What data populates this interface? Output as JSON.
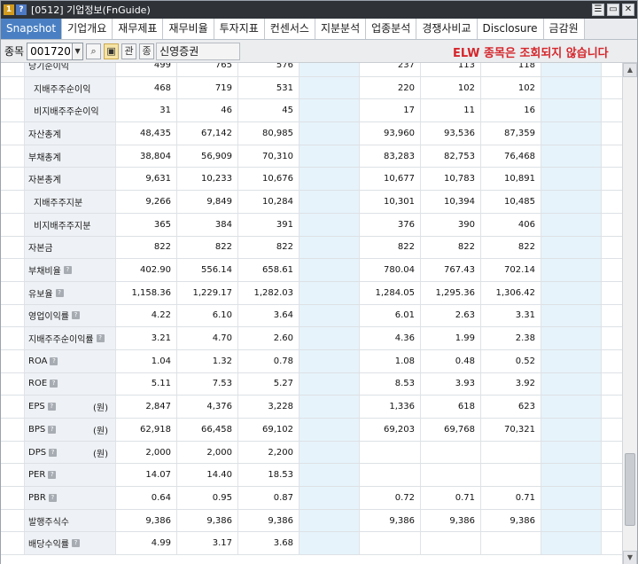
{
  "window": {
    "badge_num": "1",
    "badge_q": "?",
    "title": "[0512] 기업정보(FnGuide)",
    "controls": [
      "☰",
      "▭",
      "✕"
    ]
  },
  "tabs": [
    "Snapshot",
    "기업개요",
    "재무제표",
    "재무비율",
    "투자지표",
    "컨센서스",
    "지분분석",
    "업종분석",
    "경쟁사비교",
    "Disclosure",
    "금감원"
  ],
  "search": {
    "label": "종목",
    "code": "001720",
    "dropdown_icon": "▼",
    "search_icon": "⌕",
    "folder_icon": "▣",
    "btn_gwan": "관",
    "btn_sang": "종",
    "company": "신영증권",
    "notice": "ELW 종목은 조회되지 않습니다"
  },
  "columns_blue": [
    3,
    7
  ],
  "rows": [
    {
      "label": "당기순이익",
      "level": "top",
      "q": false,
      "unit": "",
      "values": [
        "499",
        "765",
        "576",
        "",
        "237",
        "113",
        "118",
        ""
      ]
    },
    {
      "label": "지배주주순이익",
      "level": "ind",
      "q": false,
      "unit": "",
      "values": [
        "468",
        "719",
        "531",
        "",
        "220",
        "102",
        "102",
        ""
      ]
    },
    {
      "label": "비지배주주순이익",
      "level": "ind",
      "q": false,
      "unit": "",
      "values": [
        "31",
        "46",
        "45",
        "",
        "17",
        "11",
        "16",
        ""
      ]
    },
    {
      "label": "자산총계",
      "level": "top",
      "q": false,
      "unit": "",
      "values": [
        "48,435",
        "67,142",
        "80,985",
        "",
        "93,960",
        "93,536",
        "87,359",
        ""
      ]
    },
    {
      "label": "부채총계",
      "level": "top",
      "q": false,
      "unit": "",
      "values": [
        "38,804",
        "56,909",
        "70,310",
        "",
        "83,283",
        "82,753",
        "76,468",
        ""
      ]
    },
    {
      "label": "자본총계",
      "level": "top",
      "q": false,
      "unit": "",
      "values": [
        "9,631",
        "10,233",
        "10,676",
        "",
        "10,677",
        "10,783",
        "10,891",
        ""
      ]
    },
    {
      "label": "지배주주지분",
      "level": "ind",
      "q": false,
      "unit": "",
      "values": [
        "9,266",
        "9,849",
        "10,284",
        "",
        "10,301",
        "10,394",
        "10,485",
        ""
      ]
    },
    {
      "label": "비지배주주지분",
      "level": "ind",
      "q": false,
      "unit": "",
      "values": [
        "365",
        "384",
        "391",
        "",
        "376",
        "390",
        "406",
        ""
      ]
    },
    {
      "label": "자본금",
      "level": "top",
      "q": false,
      "unit": "",
      "values": [
        "822",
        "822",
        "822",
        "",
        "822",
        "822",
        "822",
        ""
      ]
    },
    {
      "label": "부채비율",
      "level": "top",
      "q": true,
      "unit": "",
      "values": [
        "402.90",
        "556.14",
        "658.61",
        "",
        "780.04",
        "767.43",
        "702.14",
        ""
      ]
    },
    {
      "label": "유보율",
      "level": "top",
      "q": true,
      "unit": "",
      "values": [
        "1,158.36",
        "1,229.17",
        "1,282.03",
        "",
        "1,284.05",
        "1,295.36",
        "1,306.42",
        ""
      ]
    },
    {
      "label": "영업이익률",
      "level": "top",
      "q": true,
      "unit": "",
      "values": [
        "4.22",
        "6.10",
        "3.64",
        "",
        "6.01",
        "2.63",
        "3.31",
        ""
      ]
    },
    {
      "label": "지배주주순이익률",
      "level": "top",
      "q": true,
      "unit": "",
      "values": [
        "3.21",
        "4.70",
        "2.60",
        "",
        "4.36",
        "1.99",
        "2.38",
        ""
      ]
    },
    {
      "label": "ROA",
      "level": "top",
      "q": true,
      "unit": "",
      "values": [
        "1.04",
        "1.32",
        "0.78",
        "",
        "1.08",
        "0.48",
        "0.52",
        ""
      ]
    },
    {
      "label": "ROE",
      "level": "top",
      "q": true,
      "unit": "",
      "values": [
        "5.11",
        "7.53",
        "5.27",
        "",
        "8.53",
        "3.93",
        "3.92",
        ""
      ]
    },
    {
      "label": "EPS",
      "level": "top",
      "q": true,
      "unit": "(원)",
      "values": [
        "2,847",
        "4,376",
        "3,228",
        "",
        "1,336",
        "618",
        "623",
        ""
      ]
    },
    {
      "label": "BPS",
      "level": "top",
      "q": true,
      "unit": "(원)",
      "values": [
        "62,918",
        "66,458",
        "69,102",
        "",
        "69,203",
        "69,768",
        "70,321",
        ""
      ]
    },
    {
      "label": "DPS",
      "level": "top",
      "q": true,
      "unit": "(원)",
      "values": [
        "2,000",
        "2,000",
        "2,200",
        "",
        "",
        "",
        "",
        ""
      ]
    },
    {
      "label": "PER",
      "level": "top",
      "q": true,
      "unit": "",
      "values": [
        "14.07",
        "14.40",
        "18.53",
        "",
        "",
        "",
        "",
        ""
      ]
    },
    {
      "label": "PBR",
      "level": "top",
      "q": true,
      "unit": "",
      "values": [
        "0.64",
        "0.95",
        "0.87",
        "",
        "0.72",
        "0.71",
        "0.71",
        ""
      ]
    },
    {
      "label": "발행주식수",
      "level": "top",
      "q": false,
      "unit": "",
      "values": [
        "9,386",
        "9,386",
        "9,386",
        "",
        "9,386",
        "9,386",
        "9,386",
        ""
      ]
    },
    {
      "label": "배당수익률",
      "level": "top",
      "q": true,
      "unit": "",
      "values": [
        "4.99",
        "3.17",
        "3.68",
        "",
        "",
        "",
        "",
        ""
      ]
    }
  ],
  "scroll": {
    "up": "▲",
    "down": "▼"
  }
}
